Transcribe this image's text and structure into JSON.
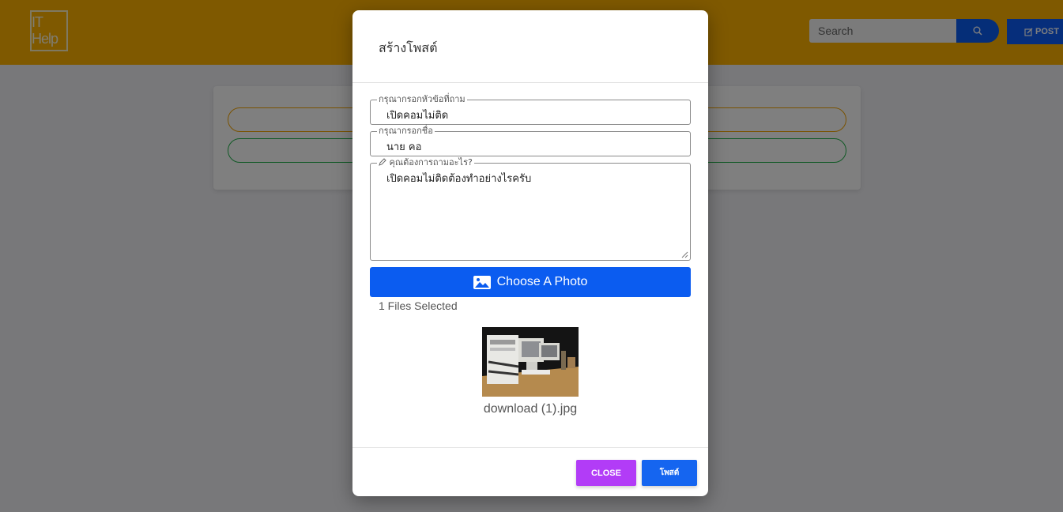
{
  "header": {
    "logo_text": "IT Help",
    "search_placeholder": "Search",
    "post_label": "POST"
  },
  "modal": {
    "title": "สร้างโพสต์",
    "topic_field": {
      "legend": "กรุณากรอกหัวข้อที่ถาม",
      "value": "เปิดคอมไม่ติด"
    },
    "name_field": {
      "legend": "กรุณากรอกชื่อ",
      "value": "นาย คอ"
    },
    "question_field": {
      "legend": "คุณต้องการถามอะไร?",
      "value": "เปิดคอมไม่ติดต้องทำอย่างไรครับ"
    },
    "choose_photo_label": "Choose A Photo",
    "files_selected": "1 Files Selected",
    "file_name": "download (1).jpg",
    "close_label": "CLOSE",
    "submit_label": "โพสต์"
  },
  "colors": {
    "header_bg": "#ffb300",
    "primary": "#0b5cf0",
    "close_button": "#b23cf7",
    "pill_orange": "#f5a400",
    "pill_green": "#21b24b"
  },
  "icons": [
    "search-icon",
    "edit-icon",
    "image-icon",
    "pencil-icon"
  ]
}
